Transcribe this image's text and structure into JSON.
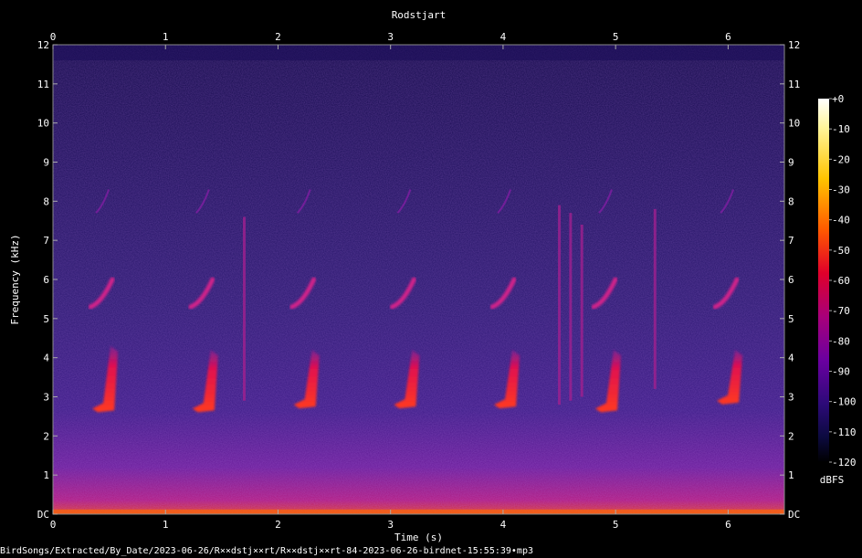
{
  "chart_data": {
    "type": "heatmap",
    "title": "Rodstjart",
    "xlabel": "Time (s)",
    "ylabel": "Frequency (kHz)",
    "xlim": [
      0,
      6.5
    ],
    "ylim": [
      0,
      12
    ],
    "x_ticks": [
      "0",
      "1",
      "2",
      "3",
      "4",
      "5",
      "6"
    ],
    "y_ticks": [
      "DC",
      "1",
      "2",
      "3",
      "4",
      "5",
      "6",
      "7",
      "8",
      "9",
      "10",
      "11",
      "12"
    ],
    "colorbar": {
      "label": "dBFS",
      "range": [
        -120,
        0
      ],
      "ticks": [
        "+0",
        "-10",
        "-20",
        "-30",
        "-40",
        "-50",
        "-60",
        "-70",
        "-80",
        "-90",
        "-100",
        "-110",
        "-120"
      ]
    },
    "calls": [
      {
        "t": 0.35,
        "low_khz": 2.7,
        "high_khz": 4.3
      },
      {
        "t": 1.24,
        "low_khz": 2.7,
        "high_khz": 4.2
      },
      {
        "t": 2.14,
        "low_khz": 2.8,
        "high_khz": 4.2
      },
      {
        "t": 3.03,
        "low_khz": 2.8,
        "high_khz": 4.2
      },
      {
        "t": 3.92,
        "low_khz": 2.8,
        "high_khz": 4.2
      },
      {
        "t": 4.82,
        "low_khz": 2.7,
        "high_khz": 4.2
      },
      {
        "t": 5.9,
        "low_khz": 2.9,
        "high_khz": 4.2
      }
    ]
  },
  "footer": {
    "file_path": "BirdSongs/Extracted/By_Date/2023-06-26/R××dstj××rt/R××dstj××rt-84-2023-06-26-birdnet-15:55:39•mp3"
  },
  "colors": {
    "background": "#000000",
    "spectrogram_base": "#2a1870",
    "call_core": "#ff3a20",
    "noise_floor": "#b01a80"
  }
}
